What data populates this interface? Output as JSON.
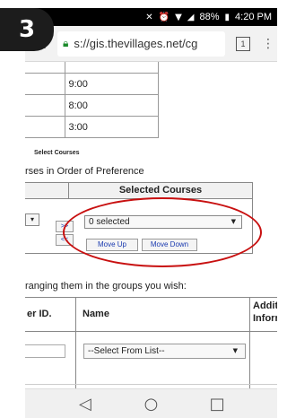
{
  "step_badge": "3",
  "status": {
    "mute_icon": "mute-icon",
    "alarm_icon": "alarm-icon",
    "wifi_icon": "wifi-icon",
    "signal_icon": "signal-icon",
    "battery": "88%",
    "battery_icon": "battery-icon",
    "time": "4:20 PM"
  },
  "browser": {
    "home_icon": "home-icon",
    "lock_icon": "lock-icon",
    "url": "s://gis.thevillages.net/cg",
    "tab_count": "1",
    "menu_icon": "menu-dots-icon"
  },
  "times": [
    "9:00",
    "8:00",
    "3:00"
  ],
  "select_courses": {
    "title": "Select Courses",
    "order_text": "rses in Order of Preference",
    "header": "Selected Courses",
    "left_select_arrow": "▾",
    "add_button": ">>",
    "remove_button": "<<",
    "selected_value": "0 selected",
    "move_up": "Move Up",
    "move_down": "Move Down"
  },
  "arranging_text": "ranging them in the groups you wish:",
  "grid": {
    "col_id": "er ID.",
    "col_name": "Name",
    "col_additional_1": "Addit",
    "col_additional_2": "Inforr",
    "name_select_value": "--Select From List--"
  },
  "nav": {
    "back_icon": "back-triangle-icon",
    "home_icon": "home-circle-icon",
    "recents_icon": "recents-square-icon"
  },
  "colors": {
    "annotation": "#c81010",
    "secure_lock": "#1a8a2a",
    "link_blue": "#1a3ab0"
  }
}
